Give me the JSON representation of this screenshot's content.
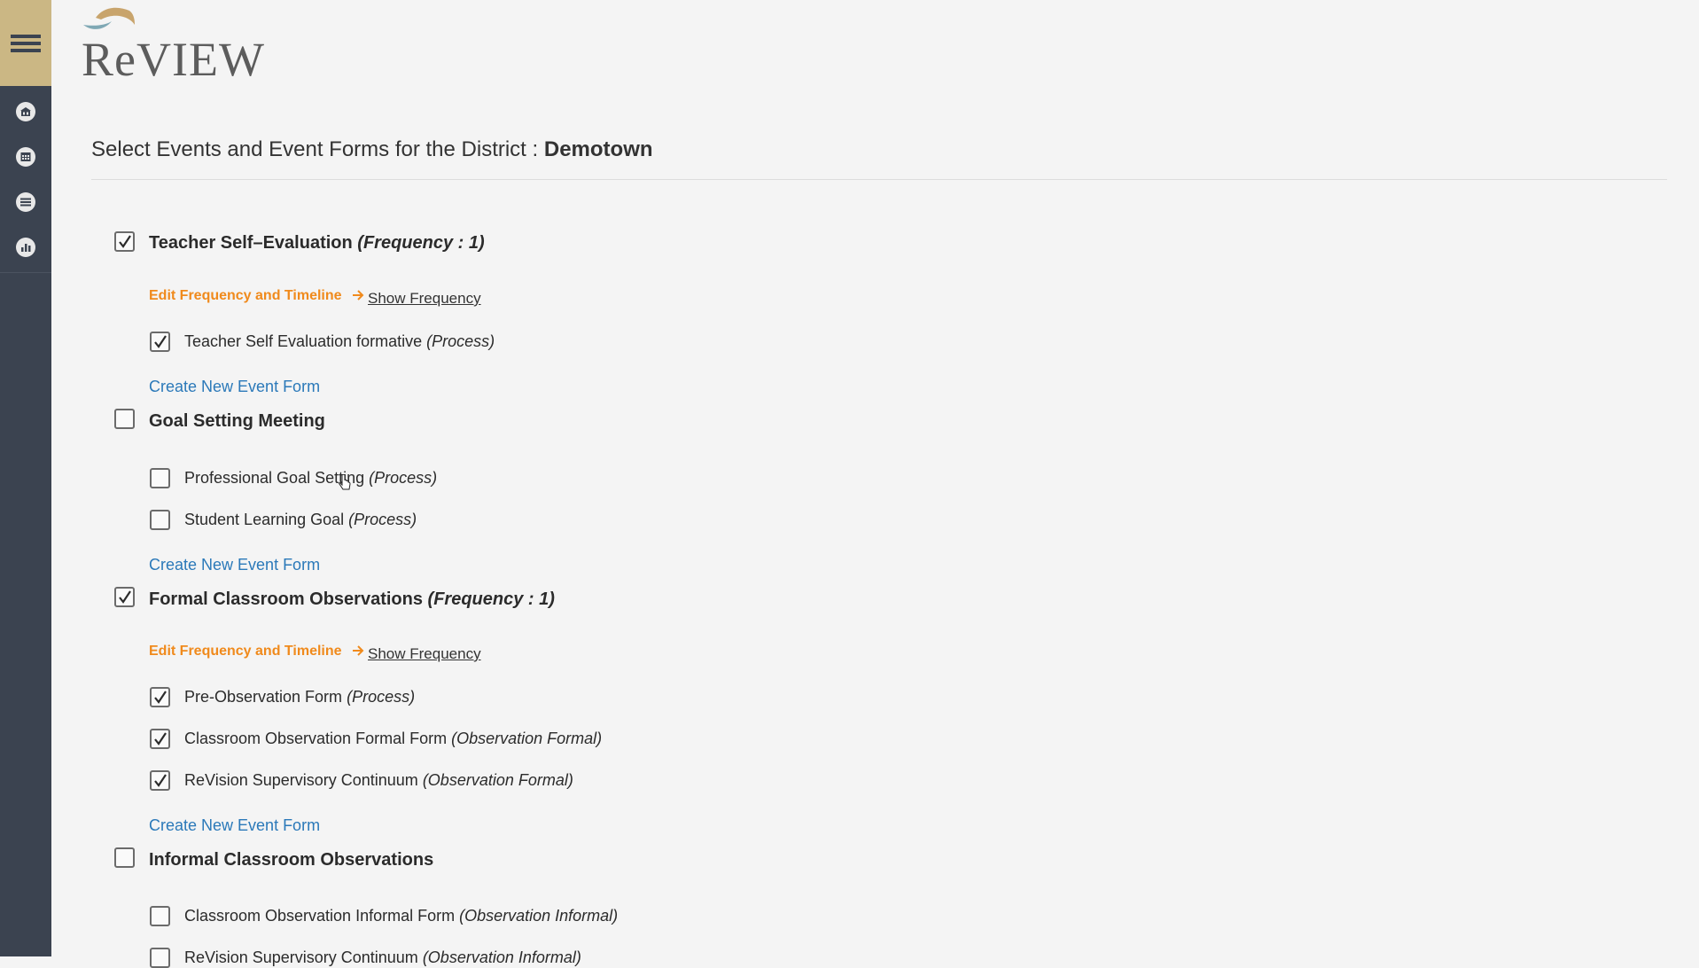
{
  "app": {
    "logo_text": "ReVIEW"
  },
  "sidebar": {
    "menu_icon": "hamburger-icon",
    "items": [
      {
        "icon": "building-icon"
      },
      {
        "icon": "calendar-icon"
      },
      {
        "icon": "list-icon"
      },
      {
        "icon": "bar-chart-icon"
      }
    ]
  },
  "page": {
    "title_prefix": "Select Events and Event Forms for the District : ",
    "district": "Demotown"
  },
  "links": {
    "edit_frequency": "Edit Frequency and Timeline",
    "show_frequency": "Show Frequency",
    "create_form": "Create New Event Form"
  },
  "events": [
    {
      "name": "Teacher Self–Evaluation",
      "frequency": "(Frequency : 1)",
      "checked": true,
      "forms": [
        {
          "name": "Teacher Self Evaluation formative",
          "type": "(Process)",
          "checked": true
        }
      ]
    },
    {
      "name": "Goal Setting Meeting",
      "frequency": "",
      "checked": false,
      "forms": [
        {
          "name": "Professional Goal Setting",
          "type": "(Process)",
          "checked": false
        },
        {
          "name": "Student Learning Goal",
          "type": "(Process)",
          "checked": false
        }
      ]
    },
    {
      "name": "Formal Classroom Observations",
      "frequency": "(Frequency : 1)",
      "checked": true,
      "forms": [
        {
          "name": "Pre-Observation Form",
          "type": "(Process)",
          "checked": true
        },
        {
          "name": "Classroom Observation Formal Form",
          "type": "(Observation Formal)",
          "checked": true
        },
        {
          "name": "ReVision Supervisory Continuum",
          "type": "(Observation Formal)",
          "checked": true
        }
      ]
    },
    {
      "name": "Informal Classroom Observations",
      "frequency": "",
      "checked": false,
      "forms": [
        {
          "name": "Classroom Observation Informal Form",
          "type": "(Observation Informal)",
          "checked": false
        },
        {
          "name": "ReVision Supervisory Continuum",
          "type": "(Observation Informal)",
          "checked": false
        }
      ]
    }
  ],
  "colors": {
    "sidebar_bg": "#3b4350",
    "menu_bg": "#cbb784",
    "edit_link": "#f08a1c",
    "create_link": "#2b79b9"
  }
}
